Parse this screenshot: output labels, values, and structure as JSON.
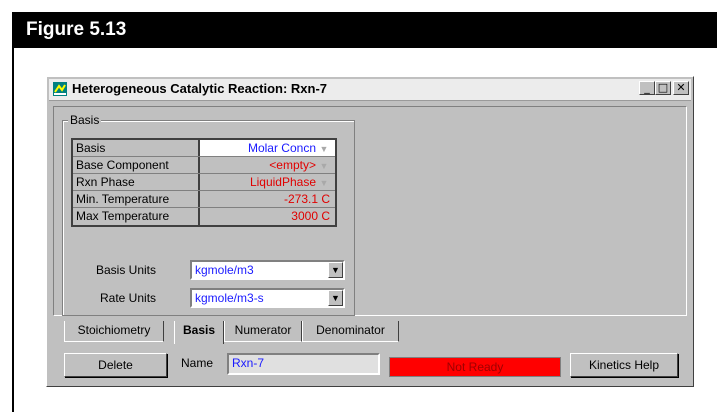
{
  "figure": {
    "title": "Figure 5.13"
  },
  "window": {
    "title": "Heterogeneous Catalytic Reaction: Rxn-7",
    "buttons": {
      "minimize": "_",
      "maximize": "□",
      "close": "✕"
    }
  },
  "basis_group": {
    "label": "Basis",
    "rows": [
      {
        "label": "Basis",
        "value": "Molar Concn",
        "dropdown": true,
        "value_color": "#1a1aff"
      },
      {
        "label": "Base Component",
        "value": "<empty>",
        "dropdown": true,
        "value_color": "#e00000"
      },
      {
        "label": "Rxn Phase",
        "value": "LiquidPhase",
        "dropdown": true,
        "value_color": "#e00000"
      },
      {
        "label": "Min. Temperature",
        "value": "-273.1 C",
        "dropdown": false,
        "value_color": "#e00000"
      },
      {
        "label": "Max Temperature",
        "value": "3000 C",
        "dropdown": false,
        "value_color": "#e00000"
      }
    ],
    "basis_units": {
      "label": "Basis Units",
      "value": "kgmole/m3"
    },
    "rate_units": {
      "label": "Rate Units",
      "value": "kgmole/m3-s"
    }
  },
  "tabs": [
    {
      "label": "Stoichiometry",
      "active": false
    },
    {
      "label": "Basis",
      "active": true
    },
    {
      "label": "Numerator",
      "active": false
    },
    {
      "label": "Denominator",
      "active": false
    }
  ],
  "footer": {
    "delete_label": "Delete",
    "name_label": "Name",
    "name_value": "Rxn-7",
    "status": "Not Ready",
    "status_color": "#ff0000",
    "help_label": "Kinetics Help"
  }
}
